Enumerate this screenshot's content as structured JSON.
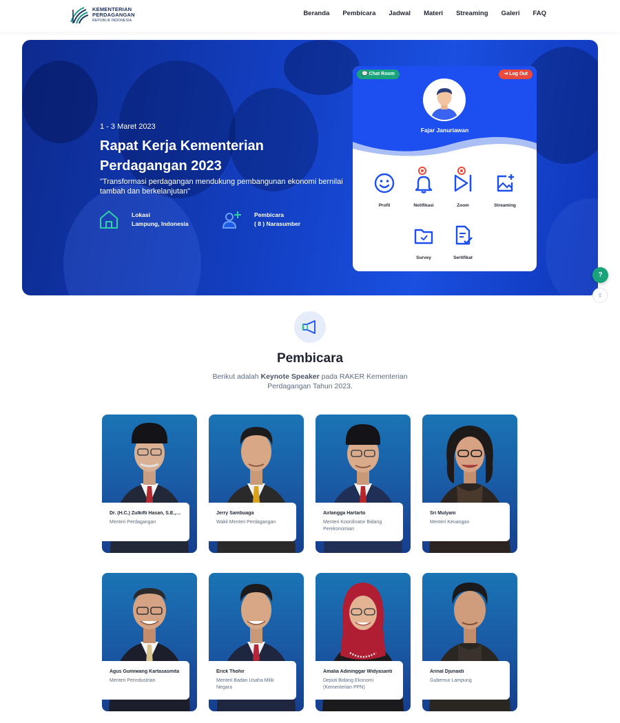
{
  "brand": {
    "line1": "KEMENTERIAN",
    "line2": "PERDAGANGAN",
    "line3": "REPUBLIK INDONESIA"
  },
  "nav": {
    "items": [
      {
        "label": "Beranda"
      },
      {
        "label": "Pembicara"
      },
      {
        "label": "Jadwal"
      },
      {
        "label": "Materi"
      },
      {
        "label": "Streaming"
      },
      {
        "label": "Galeri"
      },
      {
        "label": "FAQ"
      }
    ]
  },
  "hero": {
    "date": "1 - 3 Maret 2023",
    "title": "Rapat Kerja Kementerian Perdagangan 2023",
    "quote": "\"Transformasi perdagangan mendukung pembangunan ekonomi bernilai tambah dan berkelanjutan\"",
    "location_label": "Lokasi",
    "location_value": "Lampung, Indonesia",
    "speaker_label": "Pembicara",
    "speaker_value": "( 8 ) Narasumber"
  },
  "profile": {
    "chat_label": "Chat Room",
    "logout_label": "Log Out",
    "user_name": "Fajar Januriawan",
    "menu": [
      {
        "label": "Profil",
        "icon": "smile-icon"
      },
      {
        "label": "Notifikasi",
        "icon": "bell-icon"
      },
      {
        "label": "Zoom",
        "icon": "play-icon"
      },
      {
        "label": "Streaming",
        "icon": "image-add-icon"
      },
      {
        "label": "Survey",
        "icon": "folder-icon"
      },
      {
        "label": "Sertifikat",
        "icon": "document-check-icon"
      }
    ]
  },
  "help": {
    "label": "?",
    "up": "⇧"
  },
  "section": {
    "title": "Pembicara",
    "subtitle_pre": "Berikut adalah ",
    "subtitle_bold": "Keynote Speaker",
    "subtitle_post": " pada RAKER Kementerian Perdagangan Tahun 2023."
  },
  "speakers": [
    {
      "name": "Dr. (H.C.) Zulkifli Hasan, S.E., M.M.",
      "role": "Menteri Perdagangan"
    },
    {
      "name": "Jerry Sambuaga",
      "role": "Wakil Menteri Perdagangan"
    },
    {
      "name": "Airlangga Hartarto",
      "role": "Menteri Koordinator Bidang Perekonomian"
    },
    {
      "name": "Sri Mulyani",
      "role": "Menteri Keuangan"
    },
    {
      "name": "Agus Gumiwang Kartasasmita",
      "role": "Menteri Perindustrian"
    },
    {
      "name": "Erick Thohir",
      "role": "Menteri Badan Usaha Milik Negara"
    },
    {
      "name": "Amalia Adininggar Widyasanti",
      "role": "Deputi Bidang Ekonomi (Kementerian PPN)"
    },
    {
      "name": "Arinal Djunaidi",
      "role": "Gubernur Lampung"
    }
  ],
  "colors": {
    "brand_blue": "#1c4ef0",
    "hero_blue": "#1340c4",
    "green": "#1aa37a",
    "red": "#e94a3c"
  }
}
